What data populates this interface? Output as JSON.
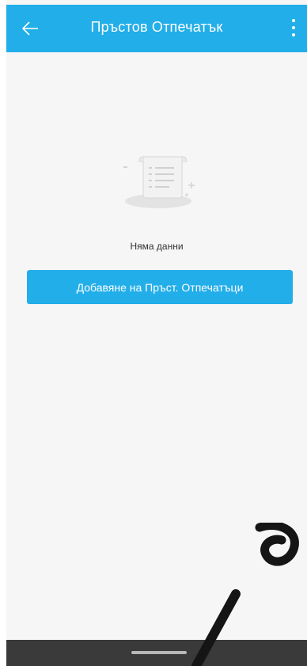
{
  "header": {
    "title": "Пръстов Отпечатък",
    "back_icon": "arrow-left-icon",
    "more_icon": "more-vertical-icon",
    "background": "#22aee9"
  },
  "empty_state": {
    "icon": "empty-document-icon",
    "message": "Няма данни"
  },
  "actions": {
    "add_button_label": "Добавяне на Пръст. Отпечатъци",
    "accent": "#22aee9"
  },
  "nav_bar": {
    "home_indicator": "home-pill-icon"
  }
}
